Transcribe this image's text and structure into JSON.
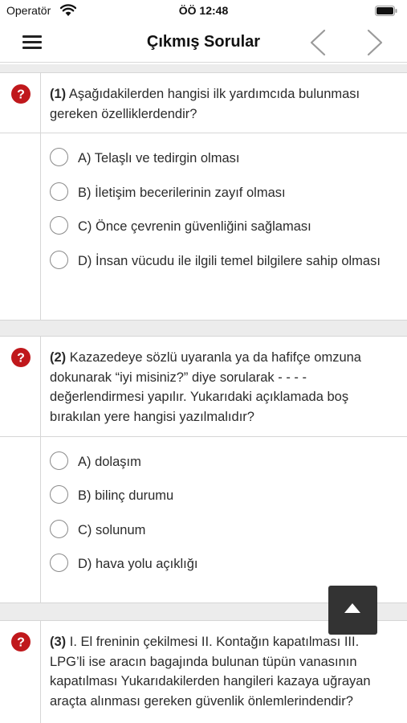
{
  "status_bar": {
    "carrier": "Operatör",
    "time": "ÖÖ 12:48"
  },
  "nav": {
    "title": "Çıkmış Sorular"
  },
  "questions": [
    {
      "number": "(1)",
      "text": " Aşağıdakilerden hangisi ilk yardımcıda bulunması gereken özelliklerdendir?",
      "options": [
        "A) Telaşlı ve tedirgin olması",
        "B) İletişim becerilerinin zayıf olması",
        "C) Önce çevrenin güvenliğini sağlaması",
        "D) İnsan vücudu ile ilgili temel bilgilere sahip olması"
      ]
    },
    {
      "number": "(2)",
      "text": " Kazazedeye sözlü uyaranla ya da hafifçe omzuna dokunarak “iyi misiniz?” diye sorularak - - - - değerlendirmesi yapılır. Yukarıdaki açıklamada boş bırakılan yere hangisi yazılmalıdır?",
      "options": [
        "A) dolaşım",
        "B) bilinç durumu",
        "C) solunum",
        "D) hava yolu açıklığı"
      ]
    },
    {
      "number": "(3)",
      "text": " I. El freninin çekilmesi II. Kontağın kapatılması III. LPG’li ise aracın bagajında bulunan tüpün vanasının kapatılması Yukarıdakilerden hangileri kazaya uğrayan araçta alınması gereken güvenlik önlemlerindendir?"
    }
  ],
  "colors": {
    "question_icon": "#c0181c",
    "scroll_button": "#333333"
  }
}
